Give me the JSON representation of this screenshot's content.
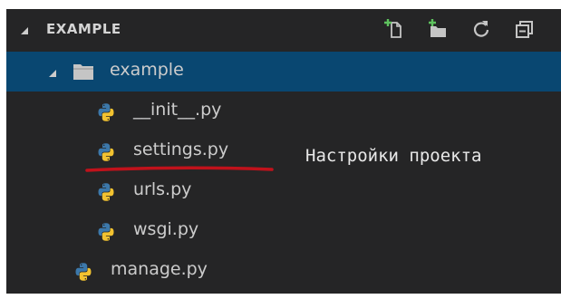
{
  "explorer": {
    "section": {
      "title": "EXAMPLE",
      "actions": [
        {
          "name": "new-file",
          "icon": "new-file-icon"
        },
        {
          "name": "new-folder",
          "icon": "new-folder-icon"
        },
        {
          "name": "refresh",
          "icon": "refresh-icon"
        },
        {
          "name": "collapse-all",
          "icon": "collapse-all-icon"
        }
      ]
    },
    "tree": {
      "folder": {
        "label": "example",
        "icon": "folder-icon",
        "expanded": true,
        "selected": true
      },
      "files": [
        {
          "label": "__init__.py",
          "icon": "python-icon"
        },
        {
          "label": "settings.py",
          "icon": "python-icon"
        },
        {
          "label": "urls.py",
          "icon": "python-icon"
        },
        {
          "label": "wsgi.py",
          "icon": "python-icon"
        }
      ],
      "root_file": {
        "label": "manage.py",
        "icon": "python-icon"
      }
    }
  },
  "annotation": {
    "text": "Настройки проекта",
    "underline_color": "#c0121b"
  },
  "colors": {
    "background": "#252526",
    "selection": "#094771",
    "text": "#cccccc",
    "python_blue": "#3c78aa",
    "python_yellow": "#f2c230",
    "add_green": "#5ec25e"
  }
}
